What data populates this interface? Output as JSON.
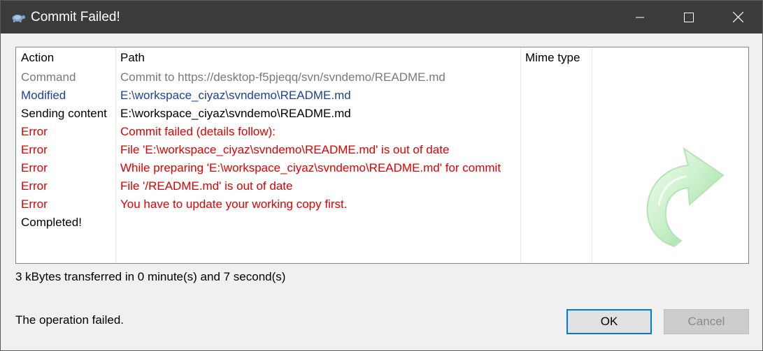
{
  "window": {
    "title": "Commit Failed!",
    "app_icon": "tortoise-icon",
    "controls": [
      "minimize-icon",
      "maximize-icon",
      "close-icon"
    ]
  },
  "log": {
    "headers": {
      "action": "Action",
      "path": "Path",
      "mime_type": "Mime type"
    },
    "rows": [
      {
        "action": "Command",
        "path": "Commit to https://desktop-f5pjeqq/svn/svndemo/README.md",
        "color": "#7a7a7a"
      },
      {
        "action": "Modified",
        "path": "E:\\workspace_ciyaz\\svndemo\\README.md",
        "color": "#1f3f99"
      },
      {
        "action": "Sending content",
        "path": "E:\\workspace_ciyaz\\svndemo\\README.md",
        "color": "#000000"
      },
      {
        "action": "Error",
        "path": "Commit failed (details follow):",
        "color": "#e00000"
      },
      {
        "action": "Error",
        "path": "File 'E:\\workspace_ciyaz\\svndemo\\README.md' is out of date",
        "color": "#e00000"
      },
      {
        "action": "Error",
        "path": "While preparing 'E:\\workspace_ciyaz\\svndemo\\README.md' for commit",
        "color": "#e00000"
      },
      {
        "action": "Error",
        "path": "File '/README.md' is out of date",
        "color": "#e00000"
      },
      {
        "action": "Error",
        "path": "You have to update your working copy first.",
        "color": "#e00000"
      },
      {
        "action": "Completed!",
        "path": "",
        "color": "#000000"
      }
    ],
    "decoration_icon": "green-curved-arrow-icon"
  },
  "transfer_info": "3 kBytes transferred in 0 minute(s) and 7 second(s)",
  "status": "The operation failed.",
  "buttons": {
    "ok": "OK",
    "cancel": "Cancel"
  },
  "colors": {
    "titlebar": "#3b3b3b",
    "command": "#7a7a7a",
    "modified": "#1f3f99",
    "error": "#e00000",
    "ok_border": "#0078d7"
  }
}
